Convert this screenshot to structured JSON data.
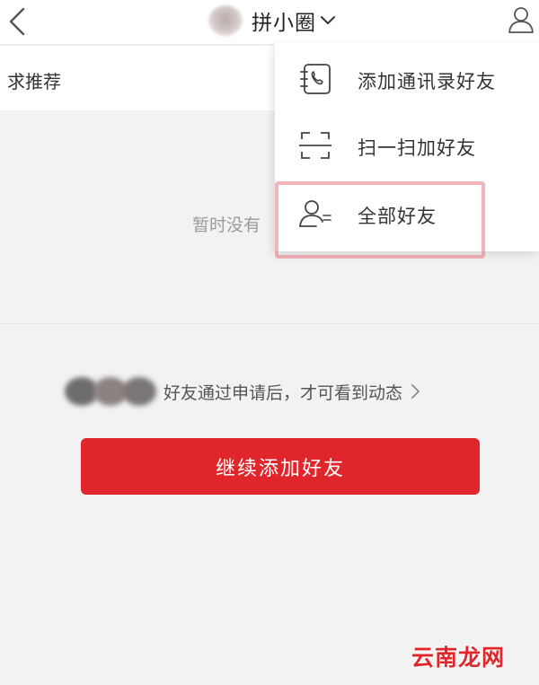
{
  "header": {
    "title": "拼小圈"
  },
  "recommend_bar": {
    "label": "求推荐"
  },
  "empty_state": {
    "text": "暂时没有"
  },
  "friends_note": {
    "text": "好友通过申请后，才可看到动态"
  },
  "cta": {
    "label": "继续添加好友"
  },
  "menu": {
    "items": [
      {
        "label": "添加通讯录好友",
        "icon": "contacts-phone-icon"
      },
      {
        "label": "扫一扫加好友",
        "icon": "scan-icon"
      },
      {
        "label": "全部好友",
        "icon": "friends-list-icon"
      }
    ]
  },
  "watermark": {
    "text": "云南龙网"
  },
  "colors": {
    "accent_red": "#e0262a",
    "highlight": "#e87882"
  }
}
